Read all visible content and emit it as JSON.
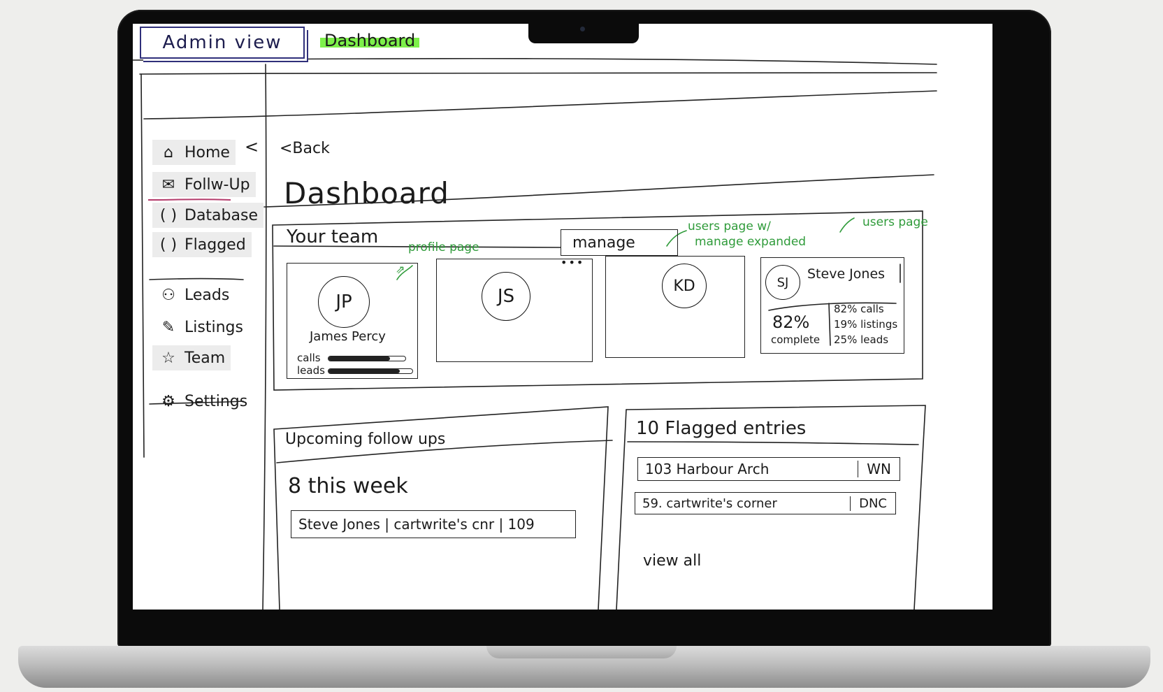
{
  "header": {
    "admin_label": "Admin view",
    "dashboard_tab": "Dashboard"
  },
  "sidebar": {
    "collapse": "<",
    "items": [
      {
        "label": "Home",
        "icon": "home-icon",
        "glyph": "⌂"
      },
      {
        "label": "Follw-Up",
        "icon": "chat-icon",
        "glyph": "✉"
      },
      {
        "label": "Database",
        "icon": "bracket-icon",
        "glyph": "( )"
      },
      {
        "label": "Flagged",
        "icon": "bracket-icon",
        "glyph": "( )"
      },
      {
        "label": "Leads",
        "icon": "people-icon",
        "glyph": "⚇"
      },
      {
        "label": "Listings",
        "icon": "edit-icon",
        "glyph": "✎"
      },
      {
        "label": "Team",
        "icon": "star-icon",
        "glyph": "☆"
      },
      {
        "label": "Settings",
        "icon": "gear-icon",
        "glyph": "⚙"
      }
    ]
  },
  "main": {
    "back": "<Back",
    "title": "Dashboard"
  },
  "team": {
    "title": "Your team",
    "manage_label": "manage",
    "notes": {
      "profile": "profile page",
      "manage_1": "users page w/",
      "manage_2": "manage expanded",
      "users": "users page"
    },
    "members": [
      {
        "initials": "JP",
        "name": "James Percy",
        "stat_labels": [
          "calls",
          "leads"
        ],
        "stat_values": [
          0.8,
          0.85
        ]
      },
      {
        "initials": "JS"
      },
      {
        "initials": "KD"
      }
    ],
    "more": "•••",
    "expanded": {
      "initials": "SJ",
      "name": "Steve Jones",
      "percent": "82%",
      "percent_label": "complete",
      "breakdown": [
        "82% calls",
        "19% listings",
        "25% leads"
      ]
    }
  },
  "followups": {
    "title": "Upcoming follow ups",
    "count": "8 this week",
    "rows": [
      {
        "text": "Steve Jones | cartwrite's cnr | 109"
      }
    ]
  },
  "flagged": {
    "title": "10 Flagged entries",
    "rows": [
      {
        "address": "103 Harbour Arch",
        "tag": "WN"
      },
      {
        "address": "59. cartwrite's corner",
        "tag": "DNC"
      }
    ],
    "view_all": "view all"
  }
}
